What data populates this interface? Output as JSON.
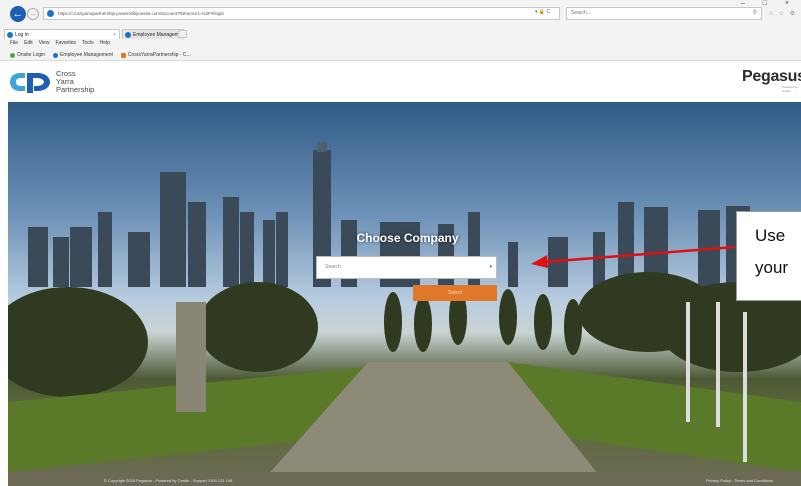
{
  "browser": {
    "url": "https://crossyarrapartnership.poweredbyonsite.com/account?ReturnUrl=%2F#/login",
    "search_placeholder": "Search...",
    "tabs": [
      {
        "label": "Log in"
      },
      {
        "label": "Employee Management"
      }
    ],
    "menu": [
      "File",
      "Edit",
      "View",
      "Favorites",
      "Tools",
      "Help"
    ],
    "favorites": [
      {
        "label": "Onsite Login",
        "color": "#5aa02c"
      },
      {
        "label": "Employee Management",
        "color": "#1a73c9"
      },
      {
        "label": "CrossYarraPartnership - C...",
        "color": "#e0782a"
      }
    ]
  },
  "header": {
    "logo_line1": "Cross",
    "logo_line2": "Yarra",
    "logo_line3": "Partnership",
    "brand_right": "Pegasus",
    "brand_right_sub": "Powered by Onsite"
  },
  "login": {
    "title": "Choose Company",
    "select_placeholder": "Search",
    "select_button": "Select"
  },
  "footer": {
    "copyright": "© Copyright 2018 Pegasus - Powered by Onsite - Support 1300 131 198",
    "links": "Privacy Policy - Terms and Conditions"
  },
  "annotation": {
    "line1": "Use",
    "line2": "your",
    "arrow_color": "#e01010"
  },
  "colors": {
    "accent": "#e0782a",
    "brand_blue": "#1e5fb4"
  }
}
